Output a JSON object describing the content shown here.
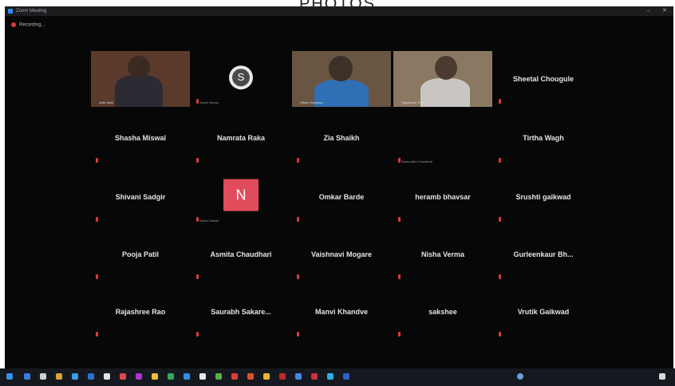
{
  "page_heading": "PHOTOS",
  "window": {
    "title": "Zoom Meeting",
    "recording_label": "Recording..."
  },
  "participants": [
    {
      "name": "Aditi Joshi",
      "kind": "video"
    },
    {
      "name": "Shruti Sabnis",
      "kind": "avatar",
      "initial": "S"
    },
    {
      "name": "Hitesh Kanjwani",
      "kind": "video"
    },
    {
      "name": "Vijaykumar Patel",
      "kind": "video",
      "active": true
    },
    {
      "name": "Sheetal Chougule",
      "kind": "name"
    },
    {
      "name": "Shasha Miswal",
      "kind": "name"
    },
    {
      "name": "Namrata Raka",
      "kind": "name"
    },
    {
      "name": "Zia Shaikh",
      "kind": "name"
    },
    {
      "name": "Samruddhi Chaudhari",
      "kind": "blank"
    },
    {
      "name": "Tirtha Wagh",
      "kind": "name"
    },
    {
      "name": "Shivani Sadgir",
      "kind": "name"
    },
    {
      "name": "Nutan Gawali",
      "kind": "avatar-n",
      "initial": "N"
    },
    {
      "name": "Omkar Barde",
      "kind": "name"
    },
    {
      "name": "heramb bhavsar",
      "kind": "name"
    },
    {
      "name": "Srushti gaikwad",
      "kind": "name"
    },
    {
      "name": "Pooja Patil",
      "kind": "name"
    },
    {
      "name": "Asmita Chaudhari",
      "kind": "name"
    },
    {
      "name": "Vaishnavi Mogare",
      "kind": "name"
    },
    {
      "name": "Nisha Verma",
      "kind": "name"
    },
    {
      "name": "Gurleenkaur Bh...",
      "kind": "name"
    },
    {
      "name": "Rajashree Rao",
      "kind": "name"
    },
    {
      "name": "Saurabh Sakare...",
      "kind": "name"
    },
    {
      "name": "Manvi Khandve",
      "kind": "name"
    },
    {
      "name": "sakshee",
      "kind": "name"
    },
    {
      "name": "Vrutik Gaikwad",
      "kind": "name"
    }
  ],
  "colors": {
    "background": "#070707",
    "active_speaker_border": "#c8c832",
    "avatar_n": "#e14c5c",
    "mute": "#d83a3a"
  }
}
